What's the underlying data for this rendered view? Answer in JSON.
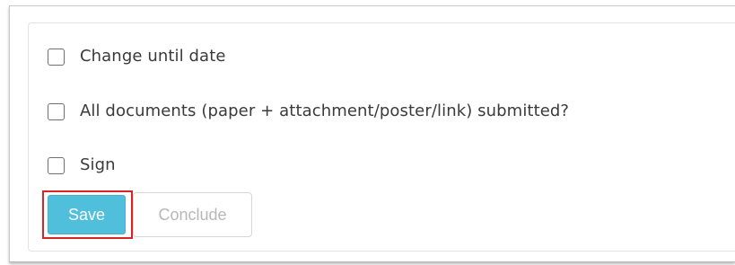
{
  "form": {
    "checkboxes": [
      {
        "label": "Change until date",
        "checked": false
      },
      {
        "label": "All documents (paper + attachment/poster/link) submitted?",
        "checked": false
      },
      {
        "label": "Sign",
        "checked": false
      }
    ],
    "buttons": {
      "save_label": "Save",
      "conclude_label": "Conclude"
    }
  },
  "colors": {
    "save_button_bg": "#4fbfdc",
    "highlight_border": "#d92424",
    "conclude_text": "#b7b7b7"
  }
}
